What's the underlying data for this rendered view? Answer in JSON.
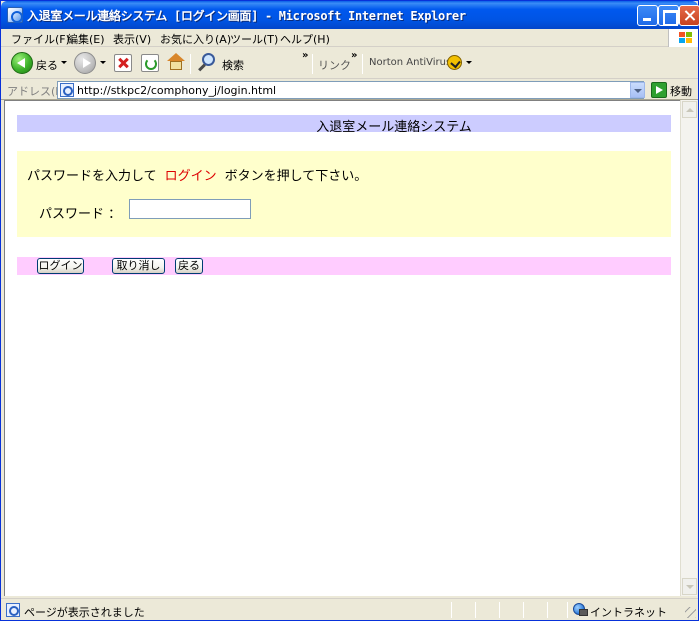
{
  "window": {
    "title": "入退室メール連絡システム [ログイン画面] - Microsoft Internet Explorer"
  },
  "menu": {
    "items": [
      {
        "label": "ファイル(F)"
      },
      {
        "label": "編集(E)"
      },
      {
        "label": "表示(V)"
      },
      {
        "label": "お気に入り(A)"
      },
      {
        "label": "ツール(T)"
      },
      {
        "label": "ヘルプ(H)"
      }
    ]
  },
  "toolbar": {
    "back_label": "戻る",
    "search_label": "検索",
    "links_label": "リンク",
    "chevron": "»",
    "norton_label": "Norton AntiVirus"
  },
  "address": {
    "label": "アドレス(D)",
    "url": "http://stkpc2/comphony_j/login.html",
    "go_label": "移動"
  },
  "page": {
    "header_title": "入退室メール連絡システム",
    "instruction_before": "パスワードを入力して",
    "instruction_highlight": "ログイン",
    "instruction_after": "ボタンを押して下さい。",
    "password_label": "パスワード ：",
    "password_value": "",
    "buttons": {
      "login": "ログイン",
      "cancel": "取り消し",
      "back": "戻る"
    }
  },
  "status": {
    "text": "ページが表示されました",
    "zone": "イントラネット"
  },
  "colors": {
    "header_bg": "#ccccff",
    "panel_bg": "#ffffcc",
    "button_bar_bg": "#ffccff",
    "highlight_text": "#dd0000"
  }
}
